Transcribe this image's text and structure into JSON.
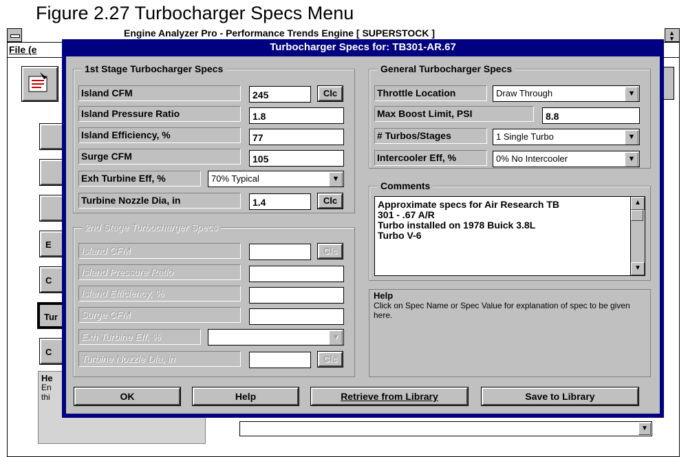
{
  "figure_caption": "Figure 2.27  Turbocharger Specs Menu",
  "background": {
    "title": "Engine Analyzer Pro - Performance Trends     Engine [ SUPERSTOCK ]",
    "menu_file": "File (e",
    "side_buttons": [
      "",
      "",
      "",
      "E",
      "C",
      "Tur",
      "C"
    ],
    "help_title": "He",
    "help_lines": [
      "En",
      "thi"
    ]
  },
  "dialog": {
    "title": "Turbocharger Specs for: TB301-AR.67",
    "stage1": {
      "title": "1st Stage Turbocharger Specs",
      "rows": [
        {
          "label": "Island CFM",
          "value": "245",
          "clc": "Clc"
        },
        {
          "label": "Island Pressure Ratio",
          "value": "1.8"
        },
        {
          "label": "Island Efficiency, %",
          "value": "77"
        },
        {
          "label": "Surge CFM",
          "value": "105"
        },
        {
          "label": "Exh Turbine Eff, %",
          "combo": "70% Typical"
        },
        {
          "label": "Turbine Nozzle Dia, in",
          "value": "1.4",
          "clc": "Clc"
        }
      ]
    },
    "stage2": {
      "title": "2nd Stage Turbocharger Specs",
      "rows": [
        {
          "label": "Island CFM",
          "value": "",
          "clc": "Clc"
        },
        {
          "label": "Island Pressure Ratio",
          "value": ""
        },
        {
          "label": "Island Efficiency, %",
          "value": ""
        },
        {
          "label": "Surge CFM",
          "value": ""
        },
        {
          "label": "Exh Turbine Eff, %",
          "combo": ""
        },
        {
          "label": "Turbine Nozzle Dia, in",
          "value": "",
          "clc": "Clc"
        }
      ]
    },
    "general": {
      "title": "General Turbocharger Specs",
      "throttle_label": "Throttle Location",
      "throttle_value": "Draw Through",
      "boost_label": "Max Boost Limit, PSI",
      "boost_value": "8.8",
      "turbos_label": "# Turbos/Stages",
      "turbos_value": "1 Single Turbo",
      "intercooler_label": "Intercooler Eff, %",
      "intercooler_value": "0% No Intercooler"
    },
    "comments": {
      "title": "Comments",
      "lines": [
        "Approximate specs for Air Research TB",
        "301 - .67 A/R",
        "Turbo installed on 1978 Buick 3.8L",
        "Turbo V-6"
      ]
    },
    "help": {
      "title": "Help",
      "text": "Click on Spec Name or Spec Value for explanation of spec to be given here."
    },
    "buttons": {
      "ok": "OK",
      "help": "Help",
      "retrieve": "Retrieve from Library",
      "save": "Save to Library"
    }
  },
  "icons": {
    "down_arrow": "▼",
    "up_arrow": "▲"
  }
}
